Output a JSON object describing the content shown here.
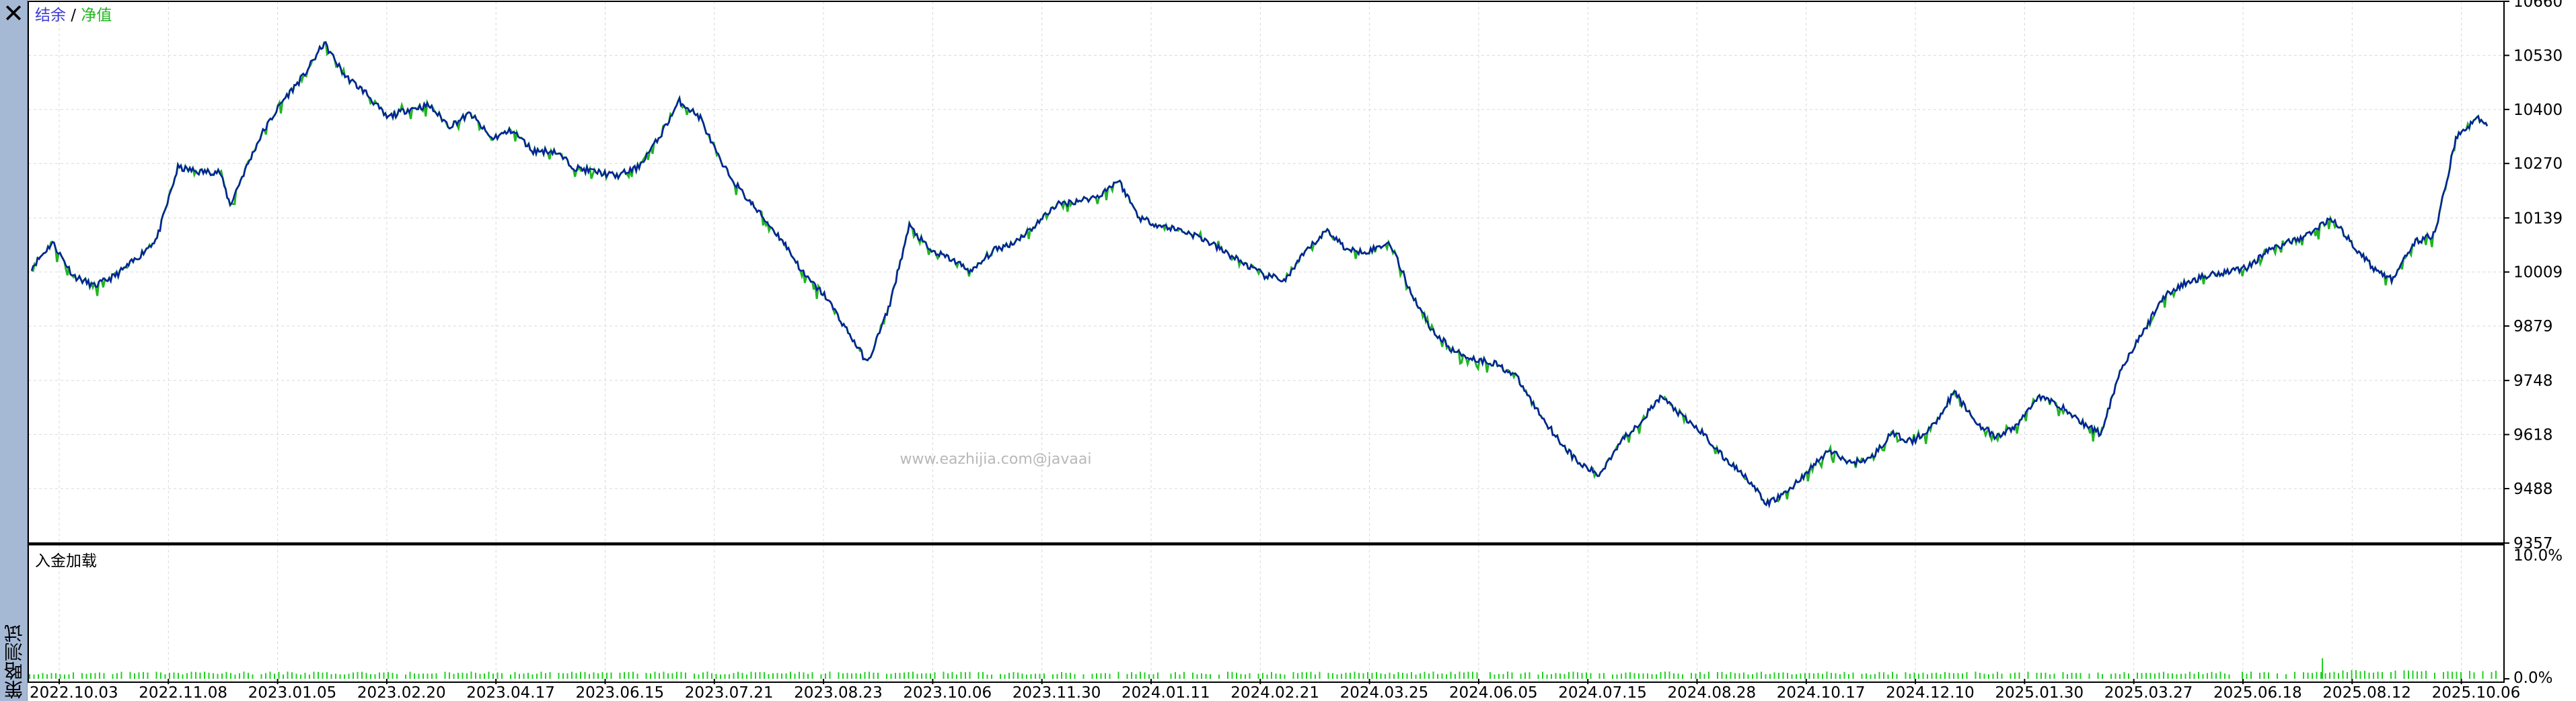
{
  "window": {
    "close_glyph": "✕",
    "side_label": "策略测试"
  },
  "watermark": "www.eazhijia.com@javaai",
  "chart_data": [
    {
      "type": "line",
      "legend": {
        "balance": "结余",
        "separator": " / ",
        "equity": "净值"
      },
      "series": [
        {
          "name": "结余",
          "color": "#0b1fa0"
        },
        {
          "name": "净值",
          "color": "#21b521"
        }
      ],
      "ylim": [
        9357,
        10660
      ],
      "yticks": [
        10660,
        10530,
        10400,
        10270,
        10139,
        10009,
        9879,
        9748,
        9618,
        9488,
        9357
      ],
      "points": [
        [
          0,
          10020
        ],
        [
          2,
          10080
        ],
        [
          4,
          10000
        ],
        [
          6,
          9975
        ],
        [
          8,
          10000
        ],
        [
          10,
          10040
        ],
        [
          12,
          10090
        ],
        [
          14,
          10260
        ],
        [
          16,
          10250
        ],
        [
          18,
          10250
        ],
        [
          19,
          10170
        ],
        [
          20,
          10230
        ],
        [
          22,
          10340
        ],
        [
          24,
          10420
        ],
        [
          26,
          10480
        ],
        [
          28,
          10560
        ],
        [
          30,
          10480
        ],
        [
          32,
          10440
        ],
        [
          34,
          10380
        ],
        [
          36,
          10400
        ],
        [
          38,
          10410
        ],
        [
          40,
          10360
        ],
        [
          42,
          10390
        ],
        [
          44,
          10330
        ],
        [
          46,
          10350
        ],
        [
          48,
          10300
        ],
        [
          50,
          10300
        ],
        [
          52,
          10260
        ],
        [
          54,
          10250
        ],
        [
          56,
          10240
        ],
        [
          58,
          10260
        ],
        [
          60,
          10330
        ],
        [
          62,
          10420
        ],
        [
          64,
          10380
        ],
        [
          66,
          10270
        ],
        [
          68,
          10200
        ],
        [
          70,
          10140
        ],
        [
          72,
          10080
        ],
        [
          74,
          10000
        ],
        [
          76,
          9950
        ],
        [
          78,
          9870
        ],
        [
          80,
          9790
        ],
        [
          82,
          9920
        ],
        [
          84,
          10120
        ],
        [
          86,
          10060
        ],
        [
          88,
          10040
        ],
        [
          90,
          10010
        ],
        [
          92,
          10060
        ],
        [
          94,
          10080
        ],
        [
          96,
          10120
        ],
        [
          98,
          10170
        ],
        [
          100,
          10180
        ],
        [
          102,
          10190
        ],
        [
          104,
          10230
        ],
        [
          106,
          10140
        ],
        [
          108,
          10120
        ],
        [
          110,
          10110
        ],
        [
          112,
          10090
        ],
        [
          114,
          10060
        ],
        [
          116,
          10030
        ],
        [
          118,
          10000
        ],
        [
          120,
          9990
        ],
        [
          122,
          10060
        ],
        [
          124,
          10110
        ],
        [
          126,
          10060
        ],
        [
          128,
          10060
        ],
        [
          130,
          10080
        ],
        [
          132,
          9960
        ],
        [
          134,
          9870
        ],
        [
          136,
          9820
        ],
        [
          138,
          9800
        ],
        [
          140,
          9790
        ],
        [
          142,
          9760
        ],
        [
          144,
          9680
        ],
        [
          146,
          9610
        ],
        [
          148,
          9550
        ],
        [
          150,
          9520
        ],
        [
          152,
          9600
        ],
        [
          154,
          9650
        ],
        [
          156,
          9710
        ],
        [
          158,
          9660
        ],
        [
          160,
          9620
        ],
        [
          162,
          9560
        ],
        [
          164,
          9520
        ],
        [
          166,
          9450
        ],
        [
          168,
          9480
        ],
        [
          170,
          9530
        ],
        [
          172,
          9580
        ],
        [
          174,
          9550
        ],
        [
          176,
          9560
        ],
        [
          178,
          9620
        ],
        [
          180,
          9600
        ],
        [
          182,
          9640
        ],
        [
          184,
          9720
        ],
        [
          186,
          9650
        ],
        [
          188,
          9610
        ],
        [
          190,
          9640
        ],
        [
          192,
          9710
        ],
        [
          194,
          9690
        ],
        [
          196,
          9650
        ],
        [
          198,
          9620
        ],
        [
          200,
          9780
        ],
        [
          202,
          9860
        ],
        [
          204,
          9950
        ],
        [
          206,
          9980
        ],
        [
          208,
          10000
        ],
        [
          210,
          10010
        ],
        [
          212,
          10020
        ],
        [
          214,
          10060
        ],
        [
          216,
          10080
        ],
        [
          218,
          10100
        ],
        [
          220,
          10140
        ],
        [
          222,
          10080
        ],
        [
          224,
          10020
        ],
        [
          226,
          9990
        ],
        [
          228,
          10080
        ],
        [
          230,
          10100
        ],
        [
          232,
          10330
        ],
        [
          234,
          10380
        ],
        [
          235,
          10360
        ]
      ]
    },
    {
      "type": "bar",
      "title": "入金加载",
      "color": "#21d021",
      "ylim": [
        0,
        10
      ],
      "yticks": [
        "10.0%",
        "0.0%"
      ],
      "xticks": [
        "2022.10.03",
        "2022.11.08",
        "2023.01.05",
        "2023.02.20",
        "2023.04.17",
        "2023.06.15",
        "2023.07.21",
        "2023.08.23",
        "2023.10.06",
        "2023.11.30",
        "2024.01.11",
        "2024.02.21",
        "2024.03.25",
        "2024.06.05",
        "2024.07.15",
        "2024.08.28",
        "2024.10.17",
        "2024.12.10",
        "2025.01.30",
        "2025.03.27",
        "2025.06.18",
        "2025.08.12",
        "2025.10.06"
      ]
    }
  ]
}
